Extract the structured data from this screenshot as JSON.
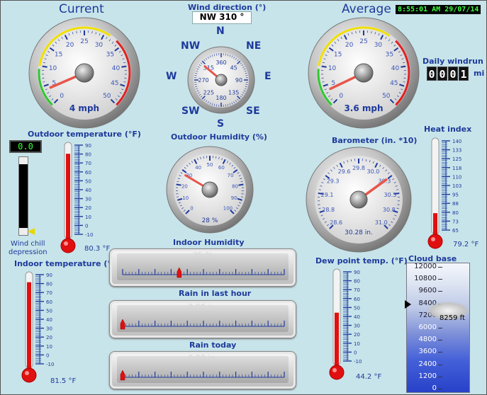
{
  "header": {
    "current_title": "Current",
    "wind_dir_title": "Wind direction (°)",
    "wind_dir_value": "NW  310 °",
    "average_title": "Average",
    "clock": "8:55:01 AM 29/07/14"
  },
  "compass": {
    "n": "N",
    "ne": "NE",
    "e": "E",
    "se": "SE",
    "s": "S",
    "sw": "SW",
    "w": "W",
    "nw": "NW"
  },
  "wind_dial": {
    "ticks": [
      "360",
      "45",
      "90",
      "135",
      "180",
      "225",
      "270",
      "315"
    ],
    "direction_deg": 310
  },
  "current_speed": {
    "ticks": [
      "0",
      "5",
      "10",
      "15",
      "20",
      "25",
      "30",
      "35",
      "40",
      "45",
      "50"
    ],
    "value": 4,
    "value_text": "4 mph"
  },
  "average_speed": {
    "ticks": [
      "0",
      "5",
      "10",
      "15",
      "20",
      "25",
      "30",
      "35",
      "40",
      "45",
      "50"
    ],
    "value": 3.6,
    "value_text": "3.6 mph"
  },
  "windrun": {
    "title": "Daily windrun",
    "digits": [
      "0",
      "0",
      "0",
      "1"
    ],
    "unit": "mi"
  },
  "outdoor_temp": {
    "title": "Outdoor temperature (°F)",
    "ticks": [
      "90",
      "80",
      "70",
      "60",
      "50",
      "40",
      "30",
      "20",
      "10",
      "0",
      "-10"
    ],
    "value": 80.3,
    "value_text": "80.3 °F"
  },
  "wind_chill": {
    "display": "0.0",
    "label_line1": "Wind chill",
    "label_line2": "depression"
  },
  "outdoor_humidity": {
    "title": "Outdoor Humidity (%)",
    "ticks": [
      "0",
      "10",
      "20",
      "30",
      "40",
      "50",
      "60",
      "70",
      "80",
      "90",
      "100"
    ],
    "value": 28,
    "value_text": "28 %"
  },
  "barometer": {
    "title": "Barometer (in. *10)",
    "ticks": [
      "28.6",
      "28.8",
      "29.1",
      "29.3",
      "29.6",
      "29.8",
      "30.0",
      "30.3",
      "30.5",
      "30.8",
      "31.0"
    ],
    "value": 30.28,
    "value_text": "30.28 in."
  },
  "heat_index": {
    "title": "Heat index",
    "ticks": [
      "140",
      "133",
      "125",
      "118",
      "110",
      "103",
      "95",
      "88",
      "80",
      "73",
      "65"
    ],
    "value": 79.2,
    "value_text": "79.2 °F"
  },
  "indoor_temp": {
    "title": "Indoor temperature (°F)",
    "ticks": [
      "90",
      "80",
      "70",
      "60",
      "50",
      "40",
      "30",
      "20",
      "10",
      "0",
      "-10"
    ],
    "value": 81.5,
    "value_text": "81.5 °F"
  },
  "indoor_humidity": {
    "title": "Indoor Humidity",
    "value": 35,
    "value_text": "35 %"
  },
  "rain_hour": {
    "title": "Rain in last hour",
    "value": 0,
    "value_text": "0.00 in."
  },
  "rain_today": {
    "title": "Rain today",
    "value": 0,
    "value_text": "0.00 in."
  },
  "dew_point": {
    "title": "Dew point temp. (°F)",
    "ticks": [
      "90",
      "80",
      "70",
      "60",
      "50",
      "40",
      "30",
      "20",
      "10",
      "0",
      "-10"
    ],
    "value": 44.2,
    "value_text": "44.2 °F"
  },
  "cloud_base": {
    "title": "Cloud base",
    "ticks": [
      "12000",
      "10800",
      "9600",
      "8400",
      "7200",
      "6000",
      "4800",
      "3600",
      "2400",
      "1200",
      "0"
    ],
    "value": 8259,
    "value_text": "8259 ft"
  },
  "colors": {
    "title_blue": "#1e3a9c",
    "background": "#c7e4ea",
    "needle": "#e8554a",
    "mercury": "#e01010",
    "clock_green": "#3dff3d"
  }
}
